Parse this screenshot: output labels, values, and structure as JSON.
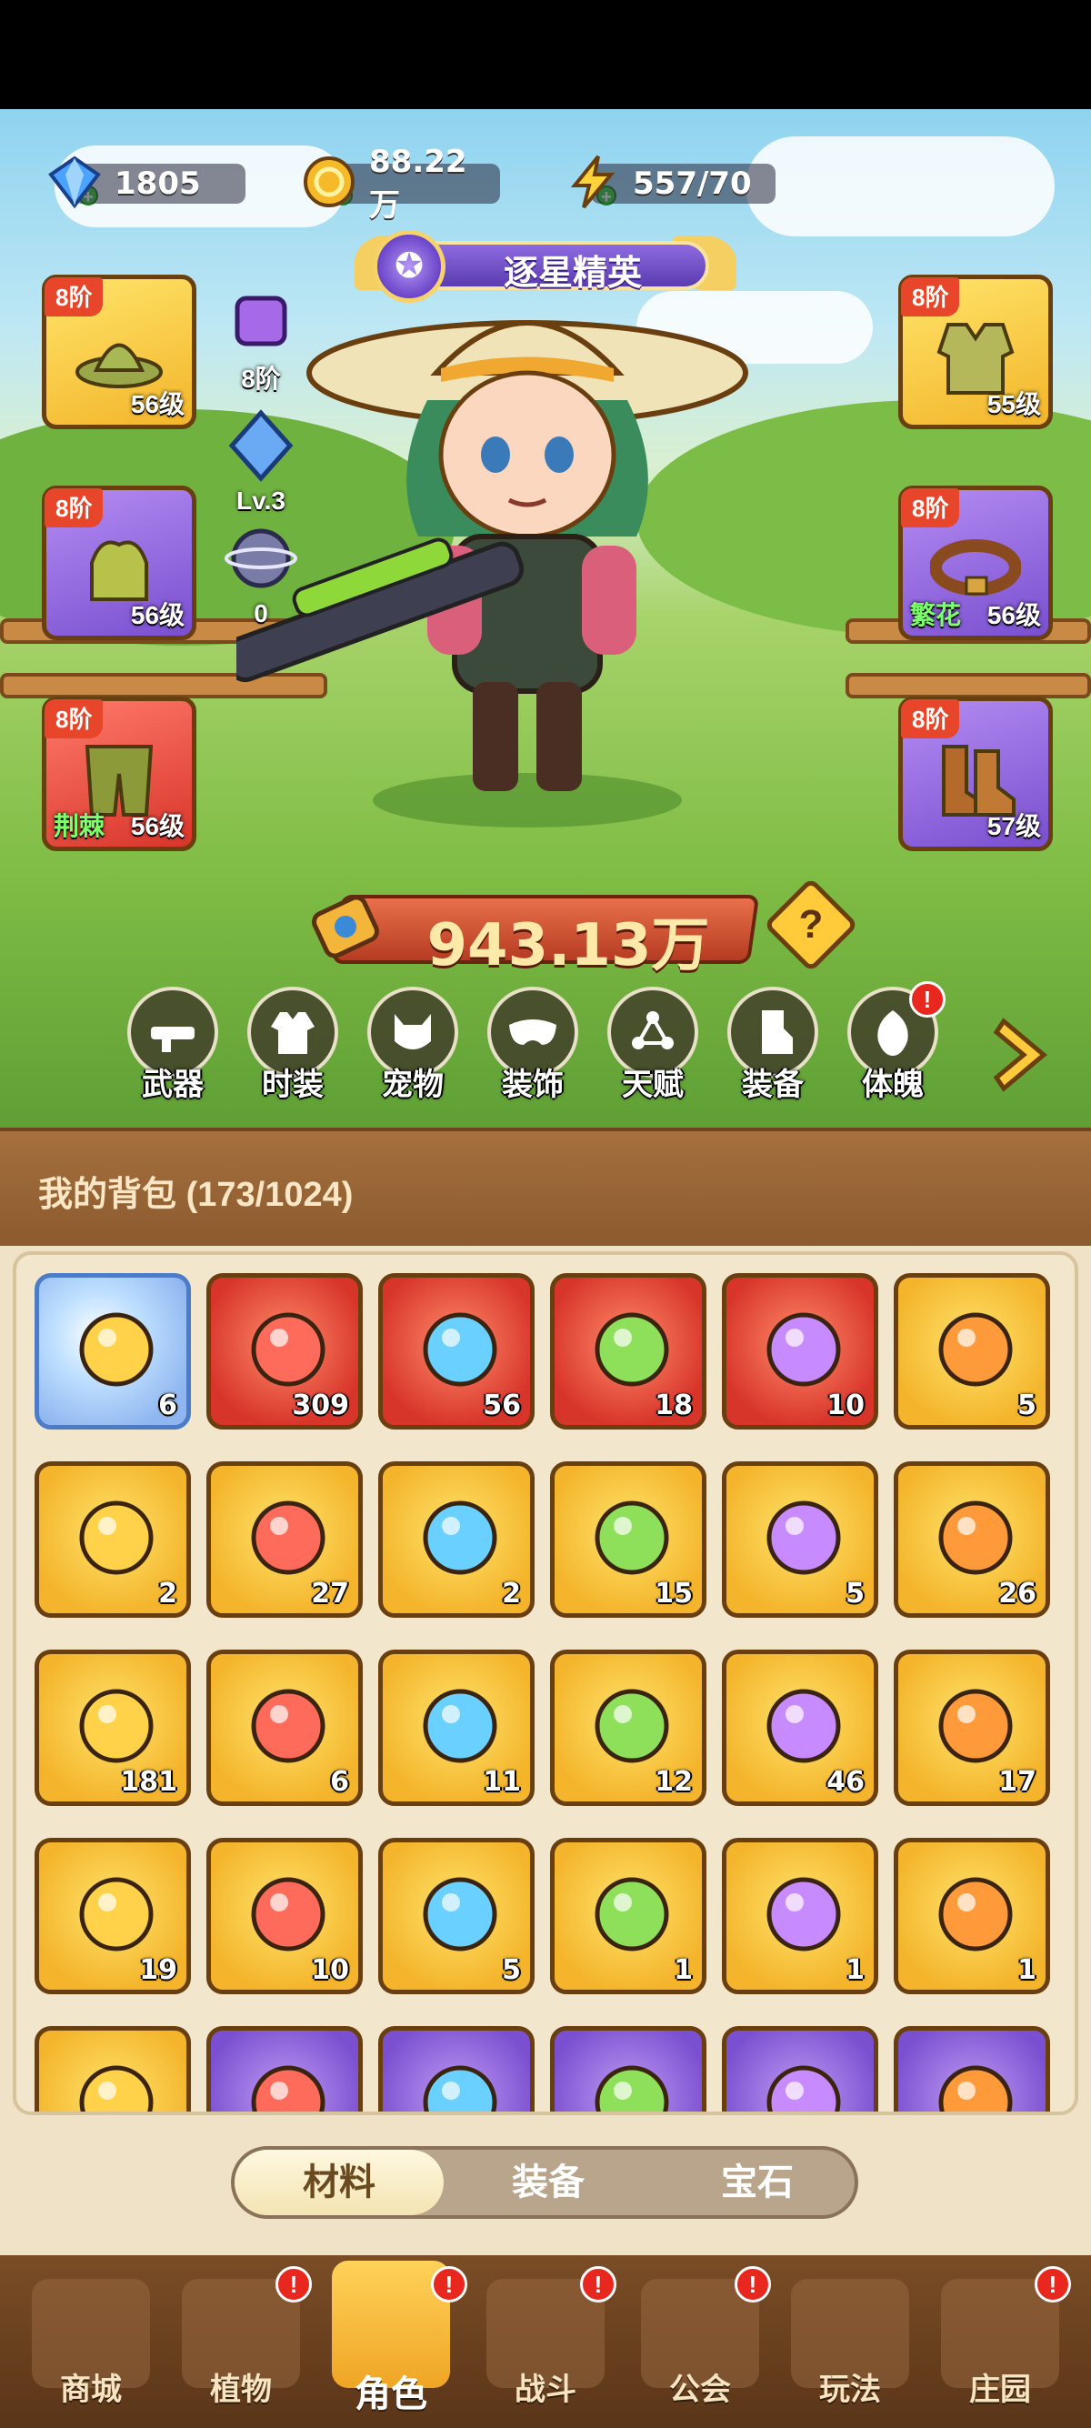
{
  "currencies": [
    {
      "name": "diamond",
      "value": "1805",
      "icon": "diamond-icon"
    },
    {
      "name": "gold",
      "value": "88.22万",
      "icon": "gold-coin-icon"
    },
    {
      "name": "energy",
      "value": "557/70",
      "icon": "lightning-icon"
    }
  ],
  "rank_title": "逐星精英",
  "equipment": {
    "left": [
      {
        "rank": "8阶",
        "level": "56级",
        "tag": "",
        "rarity": "gold",
        "icon": "hat-icon"
      },
      {
        "rank": "8阶",
        "level": "56级",
        "tag": "",
        "rarity": "purple",
        "icon": "gloves-icon"
      },
      {
        "rank": "8阶",
        "level": "56级",
        "tag": "荆棘",
        "rarity": "red",
        "icon": "pants-icon"
      }
    ],
    "right": [
      {
        "rank": "8阶",
        "level": "55级",
        "tag": "",
        "rarity": "gold",
        "icon": "vest-icon"
      },
      {
        "rank": "8阶",
        "level": "56级",
        "tag": "繁花",
        "rarity": "purple",
        "icon": "belt-icon"
      },
      {
        "rank": "8阶",
        "level": "57级",
        "tag": "",
        "rarity": "purple",
        "icon": "boots-icon"
      }
    ]
  },
  "mini_stats": [
    {
      "label": "8阶",
      "icon": "backpack-rank-icon"
    },
    {
      "label": "Lv.3",
      "icon": "crystal-icon"
    },
    {
      "label": "0",
      "icon": "planet-icon"
    }
  ],
  "combat_power": "943.13万",
  "help_symbol": "?",
  "nav_buttons": [
    {
      "label": "武器",
      "icon": "weapon-icon",
      "badge": ""
    },
    {
      "label": "时装",
      "icon": "outfit-icon",
      "badge": ""
    },
    {
      "label": "宠物",
      "icon": "pet-icon",
      "badge": ""
    },
    {
      "label": "装饰",
      "icon": "mask-icon",
      "badge": ""
    },
    {
      "label": "天赋",
      "icon": "talent-icon",
      "badge": ""
    },
    {
      "label": "装备",
      "icon": "equipment-icon",
      "badge": ""
    },
    {
      "label": "体魄",
      "icon": "physique-icon",
      "badge": "!"
    }
  ],
  "backpack": {
    "title": "我的背包",
    "capacity": "(173/1024)",
    "rows": [
      [
        {
          "count": "6",
          "rarity": "blue",
          "icon": "star-icon"
        },
        {
          "count": "309",
          "rarity": "red",
          "icon": "crystal-shard-icon"
        },
        {
          "count": "56",
          "rarity": "red",
          "icon": "red-potion-icon"
        },
        {
          "count": "18",
          "rarity": "red",
          "icon": "green-tube-icon"
        },
        {
          "count": "10",
          "rarity": "red",
          "icon": "knot-icon"
        },
        {
          "count": "5",
          "rarity": "gold",
          "icon": "amber-flask-icon"
        }
      ],
      [
        {
          "count": "2",
          "rarity": "gold",
          "icon": "water-drop-icon"
        },
        {
          "count": "27",
          "rarity": "gold",
          "icon": "skull-scroll-icon"
        },
        {
          "count": "2",
          "rarity": "gold",
          "icon": "key-icon"
        },
        {
          "count": "15",
          "rarity": "gold",
          "icon": "fire-prism-icon"
        },
        {
          "count": "5",
          "rarity": "gold",
          "icon": "flower-bud-icon"
        },
        {
          "count": "26",
          "rarity": "gold",
          "icon": "rune-stone-icon"
        }
      ],
      [
        {
          "count": "181",
          "rarity": "gold",
          "icon": "orange-potion-icon"
        },
        {
          "count": "6",
          "rarity": "gold",
          "icon": "sand-pile-icon"
        },
        {
          "count": "11",
          "rarity": "gold",
          "icon": "ore-icon"
        },
        {
          "count": "12",
          "rarity": "gold",
          "icon": "red-flower-icon"
        },
        {
          "count": "46",
          "rarity": "gold",
          "icon": "flower-pot-icon"
        },
        {
          "count": "17",
          "rarity": "gold",
          "icon": "sprayer-icon"
        }
      ],
      [
        {
          "count": "19",
          "rarity": "gold",
          "icon": "spell-book-icon"
        },
        {
          "count": "10",
          "rarity": "gold",
          "icon": "jar-icon"
        },
        {
          "count": "5",
          "rarity": "gold",
          "icon": "owl-icon"
        },
        {
          "count": "1",
          "rarity": "gold",
          "icon": "teal-potion-icon"
        },
        {
          "count": "1",
          "rarity": "gold",
          "icon": "spool-icon"
        },
        {
          "count": "1",
          "rarity": "gold",
          "icon": "glow-flower-icon"
        }
      ],
      [
        {
          "count": "",
          "rarity": "gold",
          "icon": "knot-icon"
        },
        {
          "count": "",
          "rarity": "purple",
          "icon": "potion-icon"
        },
        {
          "count": "",
          "rarity": "purple",
          "icon": "shield-icon"
        },
        {
          "count": "",
          "rarity": "purple",
          "icon": "leaf-icon"
        },
        {
          "count": "",
          "rarity": "purple",
          "icon": "scroll-icon"
        },
        {
          "count": "",
          "rarity": "purple",
          "icon": "gift-icon"
        }
      ]
    ]
  },
  "tabs": [
    {
      "label": "材料",
      "active": true
    },
    {
      "label": "装备",
      "active": false
    },
    {
      "label": "宝石",
      "active": false
    }
  ],
  "bottom_nav": [
    {
      "label": "商城",
      "icon": "shop-icon",
      "badge": ""
    },
    {
      "label": "植物",
      "icon": "plant-icon",
      "badge": "!"
    },
    {
      "label": "角色",
      "icon": "character-icon",
      "badge": "!"
    },
    {
      "label": "战斗",
      "icon": "battle-icon",
      "badge": "!"
    },
    {
      "label": "公会",
      "icon": "guild-icon",
      "badge": "!"
    },
    {
      "label": "玩法",
      "icon": "gameplay-icon",
      "badge": ""
    },
    {
      "label": "庄园",
      "icon": "manor-icon",
      "badge": "!"
    }
  ],
  "colors": {
    "gold_rarity": "#f4b52c",
    "purple_rarity": "#7a4fd0",
    "red_rarity": "#d8352a",
    "badge_red": "#e8271f"
  }
}
